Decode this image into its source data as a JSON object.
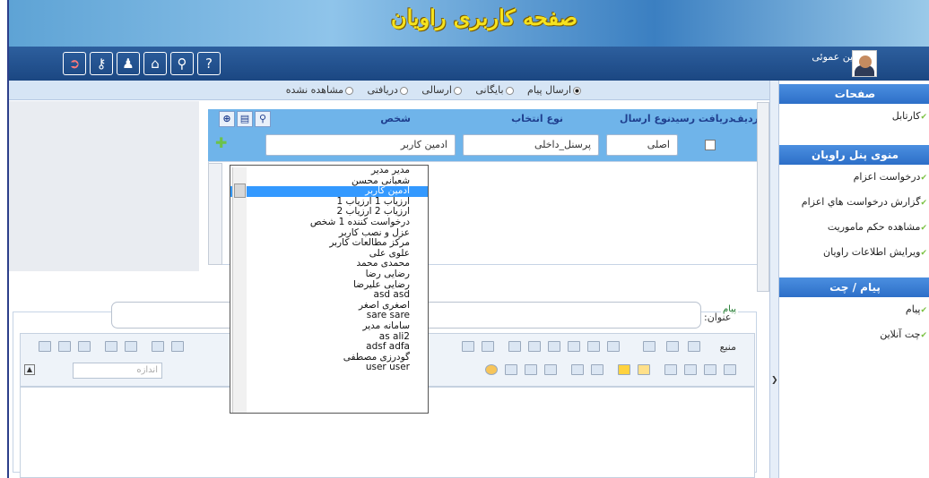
{
  "header": {
    "title": "صفحه کاربری راویان"
  },
  "user": {
    "name": "حسین عموئی"
  },
  "toolbar": {
    "icons": [
      "help-icon",
      "search-icon",
      "home-icon",
      "users-icon",
      "key-icon",
      "exit-icon"
    ]
  },
  "radio_tabs": {
    "items": [
      {
        "label": "ارسال پیام",
        "checked": true
      },
      {
        "label": "بایگانی",
        "checked": false
      },
      {
        "label": "ارسالی",
        "checked": false
      },
      {
        "label": "دریافتی",
        "checked": false
      },
      {
        "label": "مشاهده نشده",
        "checked": false
      }
    ]
  },
  "grid": {
    "headers": {
      "row": "ردیف",
      "receipt": "دریافت رسید",
      "send_type": "نوع ارسال",
      "select_type": "نوع انتخاب",
      "person": "شخص"
    },
    "row": {
      "send_type": "اصلی",
      "select_type": "پرسنل_داخلی",
      "person": "ادمین کاربر"
    }
  },
  "dropdown": {
    "selected_index": 2,
    "options": [
      "مدیر مدیر",
      "شعبانی محسن",
      "ادمین کاربر",
      "ارزیاب 1 ارزیاب 1",
      "ارزیاب 2 ارزیاب 2",
      "درخواست کننده 1 شخص",
      "عزل و نصب کاربر",
      "مرکز مطالعات کاربر",
      "علوی علی",
      "محمدی محمد",
      "رضایی رضا",
      "رضایی علیرضا",
      "asd asd",
      "اصغری اصغر",
      "sare sare",
      "سامانه مدیر",
      "as ali2",
      "adsf adfa",
      "گودرزی مصطفی",
      "user user"
    ]
  },
  "message": {
    "legend": "پیام",
    "subject_label": "عنوان:",
    "source_label": "منبع",
    "size_label": "اندازه"
  },
  "sidebar": {
    "sections": [
      {
        "title": "صفحات",
        "items": [
          "کارتابل"
        ]
      },
      {
        "title": "منوی پنل راویان",
        "items": [
          "درخواست اعزام",
          "گزارش درخواست هاي اعزام",
          "مشاهده حکم ماموريت",
          "ويرايش اطلاعات راويان"
        ]
      },
      {
        "title": "پیام / چت",
        "items": [
          "پیام",
          "چت آنلاین"
        ]
      }
    ]
  },
  "colors": {
    "banner": "#5ea3d5",
    "navbar": "#1b4782",
    "grid_header": "#6fb4ea",
    "selected": "#3399ff",
    "sidebar_header": "#2d6fc8"
  }
}
